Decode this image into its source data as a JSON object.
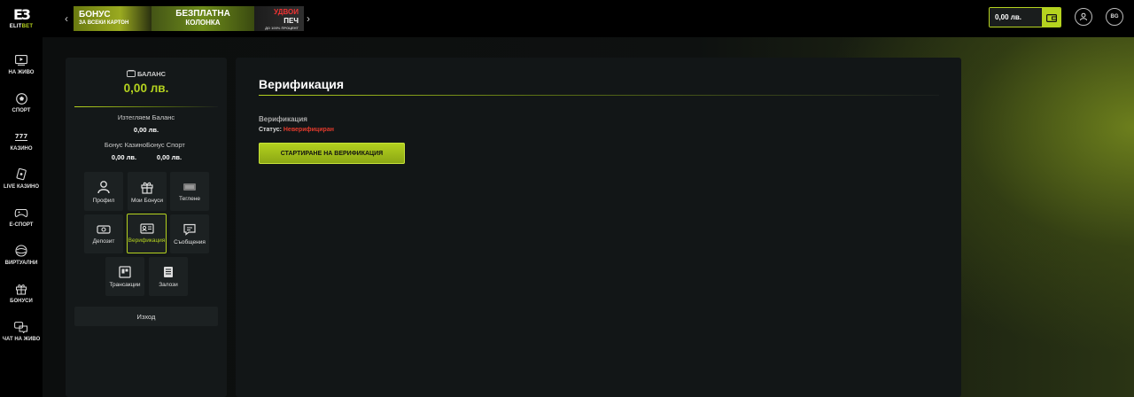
{
  "brand": {
    "mark": "E3",
    "name_white": "ELIT",
    "name_green": "BET"
  },
  "banners": [
    {
      "line1": "БОНУС",
      "line2": "ЗА ВСЕКИ КАРТОН"
    },
    {
      "line1": "БЕЗПЛАТНА",
      "line2": "КОЛОНКА"
    },
    {
      "line1": "УДВОИ",
      "line2": "ПЕЧ",
      "line3": "ДО 100% ПРОЦЕНТ"
    }
  ],
  "header": {
    "balance": "0,00 лв.",
    "language": "BG"
  },
  "nav": [
    {
      "label": "НА ЖИВО",
      "icon": "play-icon"
    },
    {
      "label": "СПОРТ",
      "icon": "soccer-ball-icon"
    },
    {
      "label": "КАЗИНО",
      "icon": "slots-777-icon"
    },
    {
      "label": "LIVE КАЗИНО",
      "icon": "live-casino-icon"
    },
    {
      "label": "Е-СПОРТ",
      "icon": "gamepad-icon"
    },
    {
      "label": "ВИРТУАЛНИ",
      "icon": "virtual-sports-icon"
    },
    {
      "label": "БОНУСИ",
      "icon": "gift-icon"
    },
    {
      "label": "ЧАТ НА ЖИВО",
      "icon": "chat-icon"
    }
  ],
  "account": {
    "balance_label": "БАЛАНС",
    "balance_value": "0,00 лв.",
    "withdrawable_label": "Изтегляем Баланс",
    "withdrawable_value": "0,00 лв.",
    "bonus_casino_label": "Бонус Казино",
    "bonus_sport_label": "Бонус Спорт",
    "bonus_casino_value": "0,00 лв.",
    "bonus_sport_value": "0,00 лв.",
    "tiles": [
      {
        "label": "Профил",
        "icon": "user-icon"
      },
      {
        "label": "Мои Бонуси",
        "icon": "gift-icon"
      },
      {
        "label": "Теглене",
        "icon": "withdraw-icon"
      },
      {
        "label": "Депозит",
        "icon": "deposit-icon"
      },
      {
        "label": "Верификация",
        "icon": "id-card-icon"
      },
      {
        "label": "Съобщения",
        "icon": "messages-icon"
      },
      {
        "label": "Трансакции",
        "icon": "transactions-icon"
      },
      {
        "label": "Залози",
        "icon": "bets-icon"
      }
    ],
    "logout_label": "Изход"
  },
  "main": {
    "title": "Верификация",
    "section_label": "Верификация",
    "status_label": "Статус:",
    "status_value": "Неверифициран",
    "start_button": "СТАРТИРАНЕ НА ВЕРИФИКАЦИЯ"
  },
  "colors": {
    "accent": "#b5d31f",
    "error": "#e23a2c",
    "panel": "#141819",
    "topbar": "#000000"
  }
}
